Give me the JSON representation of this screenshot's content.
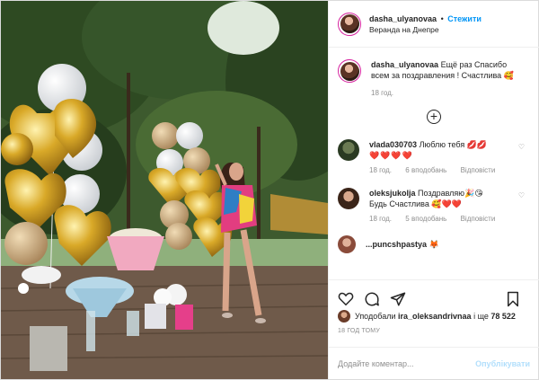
{
  "post": {
    "username": "dasha_ulyanovaa",
    "dot": "•",
    "follow_label": "Стежити",
    "location": "Веранда на Днепре"
  },
  "caption": {
    "username": "dasha_ulyanovaa",
    "text": "Ещё раз Спасибо всем за поздравления ! Счастлива 🥰",
    "time": "18 год."
  },
  "load_more_icon": "plus-circle-icon",
  "comments": [
    {
      "username": "vlada030703",
      "text": "Люблю тебя 💋💋",
      "hearts": "❤️❤️❤️❤️",
      "time": "18 год.",
      "likes": "6 вподобань",
      "reply": "Відповісти"
    },
    {
      "username": "oleksjukolja",
      "text": "Поздравляю🎉😘",
      "text2": "Будь Счастлива 🥰❤️❤️",
      "time": "18 год.",
      "likes": "5 вподобань",
      "reply": "Відповісти"
    },
    {
      "username": "...puncshpastya",
      "text": "🦊"
    }
  ],
  "likes_line": {
    "prefix": "Уподобали",
    "user": "ira_oleksandrivnaa",
    "connector": "і ще",
    "count": "78 522"
  },
  "time_ago": "18 ГОД ТОМУ",
  "add_comment": {
    "placeholder": "Додайте коментар...",
    "publish_label": "Опублікувати"
  },
  "colors": {
    "follow_blue": "#0095f6",
    "publish_disabled": "#b2dffc",
    "meta_gray": "#8e8e8e"
  }
}
